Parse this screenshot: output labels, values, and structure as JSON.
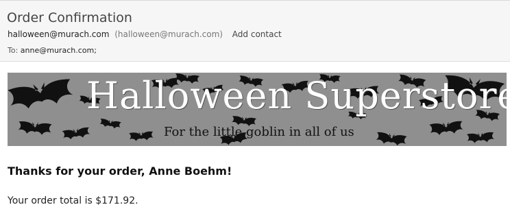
{
  "email": {
    "subject": "Order Confirmation",
    "from_name": "halloween@murach.com",
    "from_address": "(halloween@murach.com)",
    "add_contact_label": "Add contact",
    "to_label": "To:",
    "to_address": "anne@murach.com;"
  },
  "banner": {
    "title": "Halloween Superstore",
    "subtitle": "For the little goblin in all of us",
    "background_color": "#8f8f8f",
    "icon": "bat-icon"
  },
  "body": {
    "greeting": "Thanks for your order, Anne Boehm!",
    "total_text": "Your order total is $171.92."
  }
}
